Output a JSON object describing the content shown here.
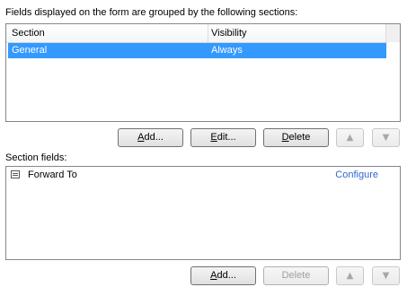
{
  "sections_label": "Fields displayed on the form are grouped by the following sections:",
  "sections_table": {
    "columns": [
      "Section",
      "Visibility"
    ],
    "rows": [
      {
        "section": "General",
        "visibility": "Always",
        "selected": true
      }
    ]
  },
  "sections_buttons": {
    "add": {
      "mnemonic": "A",
      "rest": "dd..."
    },
    "edit": {
      "mnemonic": "E",
      "rest": "dit..."
    },
    "delete": {
      "mnemonic": "D",
      "rest": "elete"
    },
    "up_icon": "arrow-up-icon",
    "down_icon": "arrow-down-icon"
  },
  "fields_label": "Section fields:",
  "fields_list": {
    "items": [
      {
        "name": "Forward To",
        "icon": "field-icon",
        "action": "Configure"
      }
    ]
  },
  "fields_buttons": {
    "add": {
      "mnemonic": "A",
      "rest": "dd..."
    },
    "delete": "Delete",
    "up_icon": "arrow-up-icon",
    "down_icon": "arrow-down-icon"
  },
  "colors": {
    "selection": "#3399ff",
    "link": "#3366cc",
    "border": "#828790"
  }
}
